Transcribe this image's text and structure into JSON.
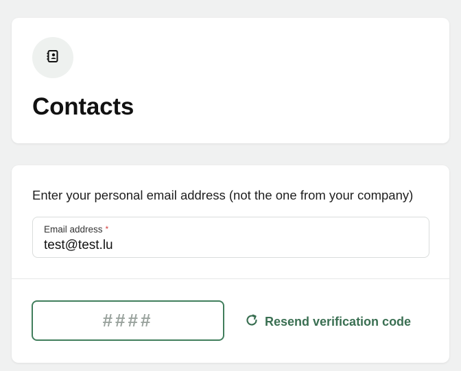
{
  "header": {
    "icon": "contacts-book-icon",
    "title": "Contacts"
  },
  "form": {
    "instruction": "Enter your personal email address (not the one from your company)",
    "email": {
      "label": "Email address",
      "required_mark": "*",
      "value": "test@test.lu"
    },
    "verification": {
      "placeholder": "####",
      "resend_label": "Resend verification code",
      "resend_icon": "refresh-icon"
    }
  },
  "colors": {
    "accent": "#3f7d5b",
    "accent_text": "#3a6f52",
    "required": "#d23c3c",
    "background": "#f0f1f1"
  }
}
